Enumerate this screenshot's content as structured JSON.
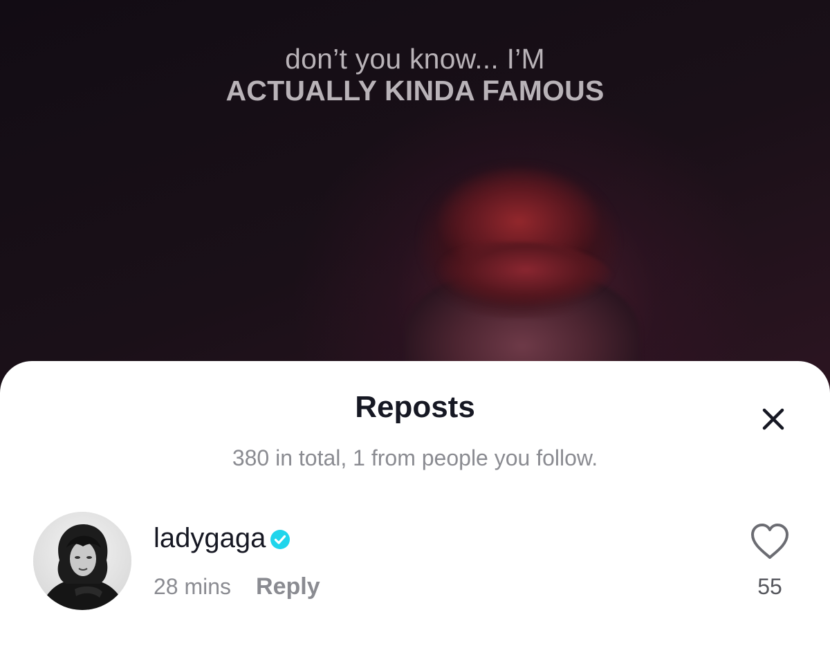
{
  "video": {
    "caption_line1": "don’t you know... I’M",
    "caption_line2": "ACTUALLY KINDA FAMOUS"
  },
  "sheet": {
    "title": "Reposts",
    "close_icon": "close-icon",
    "subtitle": "380 in total, 1 from people you follow."
  },
  "reposts": [
    {
      "username": "ladygaga",
      "verified": true,
      "time": "28 mins",
      "reply_label": "Reply",
      "likes": "55"
    }
  ],
  "colors": {
    "verified": "#20d5ec",
    "title_text": "#161823",
    "secondary_text": "#8a8b91"
  }
}
